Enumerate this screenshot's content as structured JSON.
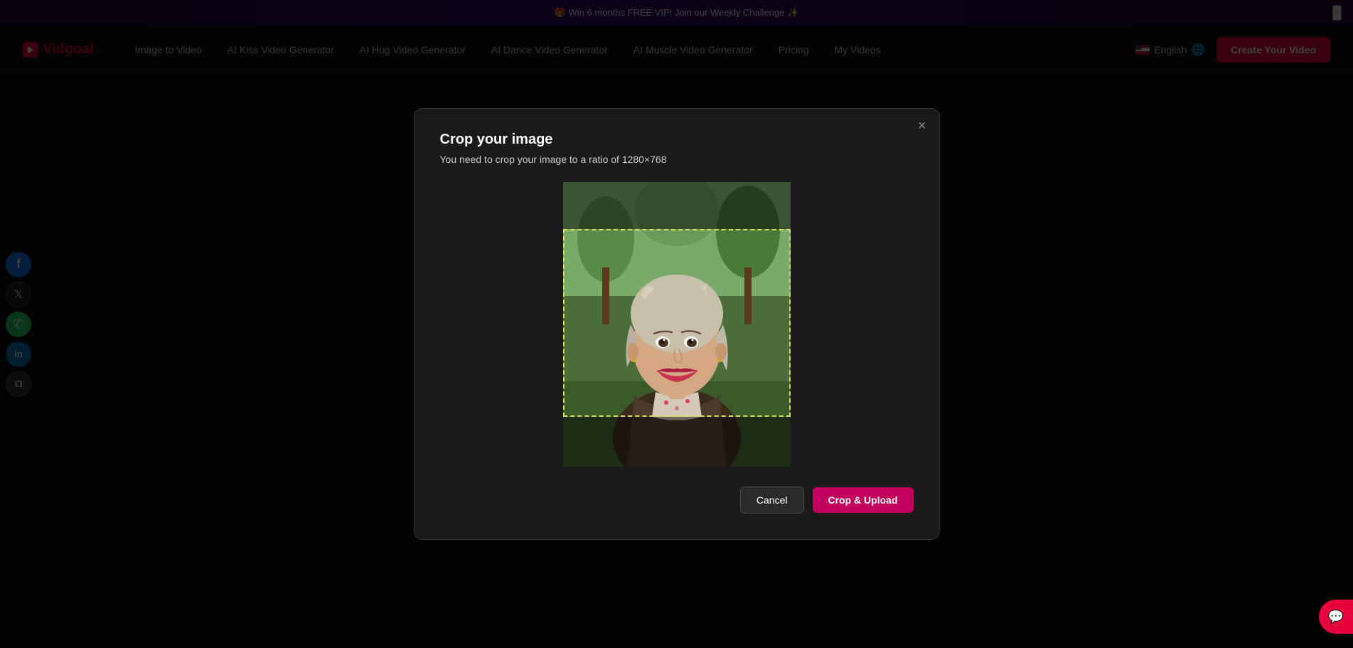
{
  "banner": {
    "text": "🎁 Win 6 months FREE VIP! Join our Weekly Challenge ✨",
    "close_label": "×"
  },
  "navbar": {
    "logo_text": "Vidgoal",
    "links": [
      {
        "label": "Image to Video",
        "id": "image-to-video"
      },
      {
        "label": "AI Kiss Video Generator",
        "id": "ai-kiss"
      },
      {
        "label": "AI Hug Video Generator",
        "id": "ai-hug"
      },
      {
        "label": "AI Dance Video Generator",
        "id": "ai-dance"
      },
      {
        "label": "AI Muscle Video Generator",
        "id": "ai-muscle"
      },
      {
        "label": "Pricing",
        "id": "pricing"
      },
      {
        "label": "My Videos",
        "id": "my-videos"
      }
    ],
    "language": "English",
    "create_btn_label": "Create Your Video"
  },
  "social_sidebar": {
    "buttons": [
      {
        "id": "facebook",
        "icon": "f",
        "label": "facebook-share"
      },
      {
        "id": "twitter",
        "icon": "𝕏",
        "label": "twitter-share"
      },
      {
        "id": "whatsapp",
        "icon": "✆",
        "label": "whatsapp-share"
      },
      {
        "id": "linkedin",
        "icon": "in",
        "label": "linkedin-share"
      },
      {
        "id": "copy",
        "icon": "⧉",
        "label": "copy-link"
      }
    ]
  },
  "modal": {
    "title": "Crop your image",
    "subtitle": "You need to crop your image to a ratio of 1280×768",
    "close_label": "×",
    "cancel_label": "Cancel",
    "crop_upload_label": "Crop & Upload"
  }
}
